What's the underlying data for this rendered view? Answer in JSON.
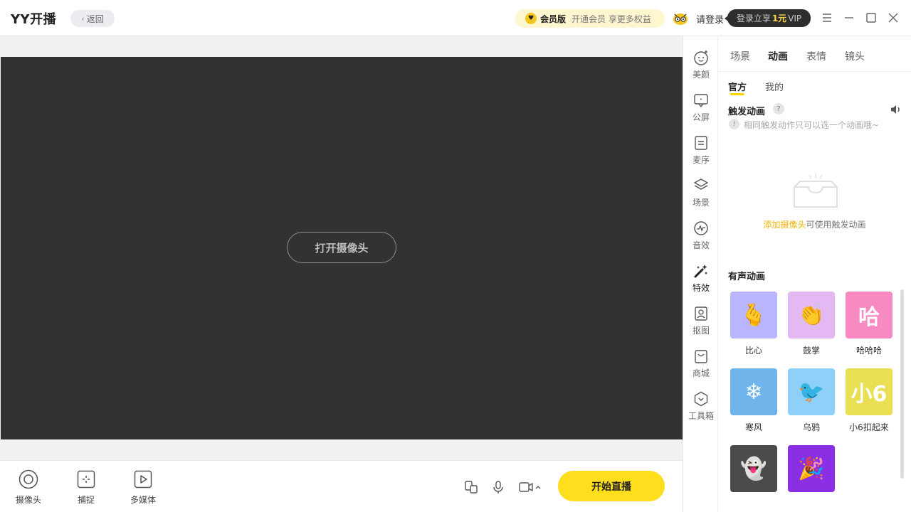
{
  "app": {
    "title": "YY开播",
    "back_label": "返回"
  },
  "header": {
    "vip_badge": "会员版",
    "vip_desc": "开通会员 享更多权益",
    "login_label": "请登录",
    "promo_prefix": "登录立享",
    "promo_price": "1元",
    "promo_suffix": "VIP"
  },
  "stage": {
    "open_camera_label": "打开摄像头"
  },
  "bottom": {
    "sources": [
      {
        "label": "摄像头",
        "icon": "camera-circle-icon"
      },
      {
        "label": "捕捉",
        "icon": "capture-icon"
      },
      {
        "label": "多媒体",
        "icon": "media-play-icon"
      }
    ],
    "start_live_label": "开始直播"
  },
  "side_toolbar": {
    "items": [
      {
        "label": "美颜",
        "icon": "beauty-face-icon"
      },
      {
        "label": "公屏",
        "icon": "chat-screen-icon"
      },
      {
        "label": "麦序",
        "icon": "mic-queue-icon"
      },
      {
        "label": "场景",
        "icon": "layers-icon"
      },
      {
        "label": "音效",
        "icon": "sound-wave-icon"
      },
      {
        "label": "特效",
        "icon": "magic-wand-icon"
      },
      {
        "label": "抠图",
        "icon": "portrait-cutout-icon"
      },
      {
        "label": "商城",
        "icon": "shop-bag-icon"
      },
      {
        "label": "工具箱",
        "icon": "toolbox-icon"
      }
    ],
    "active_index": 5
  },
  "panel": {
    "tabs": [
      "场景",
      "动画",
      "表情",
      "镜头"
    ],
    "active_tab": 1,
    "subtabs": [
      "官方",
      "我的"
    ],
    "active_subtab": 0,
    "trigger_title": "触发动画",
    "trigger_hint": "相同触发动作只可以选一个动画哦~",
    "empty_link": "添加摄像头",
    "empty_text": "可使用触发动画",
    "sound_title": "有声动画",
    "animations": [
      {
        "label": "比心",
        "glyph": "🫰",
        "bg": "#b9b5ff"
      },
      {
        "label": "鼓掌",
        "glyph": "👏",
        "bg": "#e4b8f3"
      },
      {
        "label": "哈哈哈",
        "glyph": "哈",
        "bg": "#f78ac3"
      },
      {
        "label": "寒风",
        "glyph": "❄",
        "bg": "#6fb4ea"
      },
      {
        "label": "乌鸦",
        "glyph": "🐦",
        "bg": "#8ed0f7"
      },
      {
        "label": "小6扣起来",
        "glyph": "小6",
        "bg": "#e8df53"
      },
      {
        "label": "",
        "glyph": "👻",
        "bg": "#4b4b4b"
      },
      {
        "label": "",
        "glyph": "🎉",
        "bg": "#8b2fe5"
      }
    ]
  },
  "colors": {
    "accent": "#ffde1e",
    "preview_bg": "#323232",
    "link": "#f5b400"
  }
}
